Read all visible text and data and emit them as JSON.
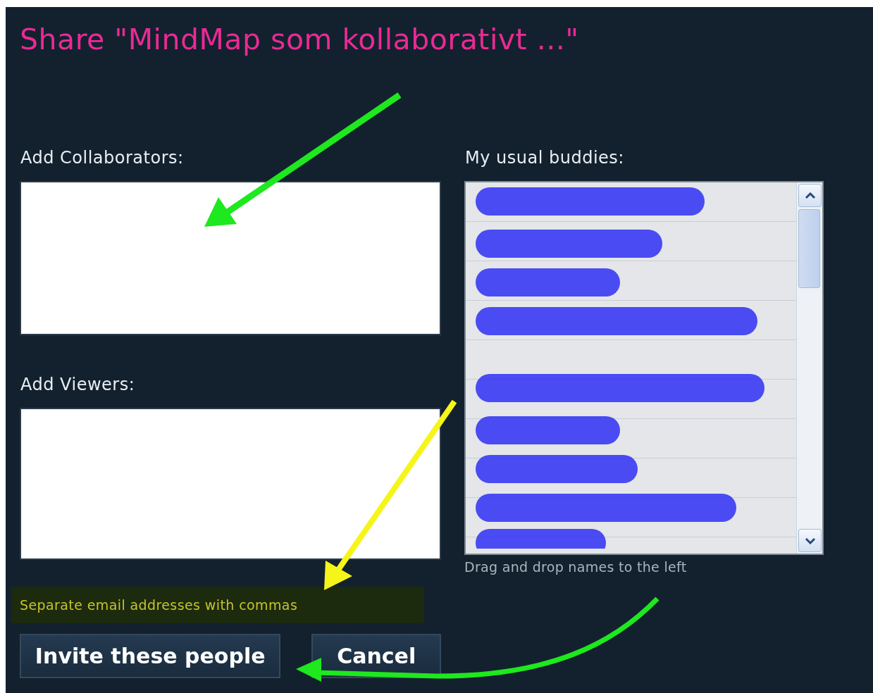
{
  "dialog": {
    "title": "Share \"MindMap som kollaborativt ...\"",
    "collaborators": {
      "label": "Add Collaborators:"
    },
    "viewers": {
      "label": "Add Viewers:"
    },
    "buddies": {
      "label": "My usual buddies:",
      "hint": "Drag and drop names to the left"
    },
    "note": "Separate email addresses with commas",
    "buttons": [
      {
        "label": "Invite these people"
      },
      {
        "label": "Cancel"
      }
    ]
  }
}
